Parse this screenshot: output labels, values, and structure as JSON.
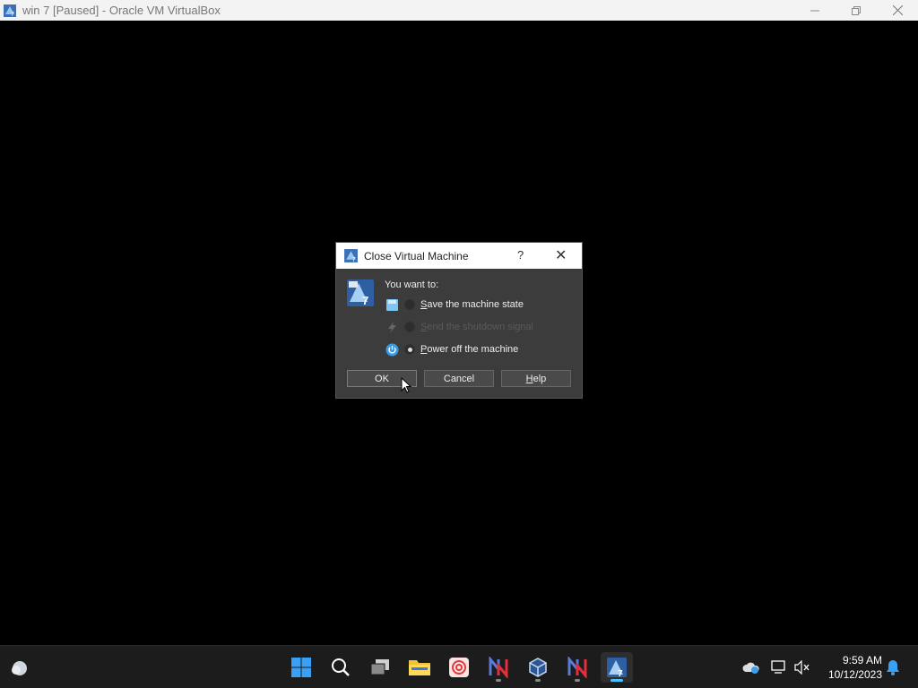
{
  "window": {
    "title": "win 7 [Paused] - Oracle VM VirtualBox",
    "controls": [
      "minimize",
      "restore",
      "close"
    ]
  },
  "dialog": {
    "title": "Close Virtual Machine",
    "help_glyph": "?",
    "close_glyph": "✕",
    "prompt": "You want to:",
    "options": [
      {
        "label_prefix": "S",
        "label_rest": "ave the machine state",
        "icon": "save-state-icon",
        "enabled": true,
        "selected": false
      },
      {
        "label_prefix": "S",
        "label_rest": "end the shutdown signal",
        "icon": "shutdown-signal-icon",
        "enabled": false,
        "selected": false
      },
      {
        "label_prefix": "P",
        "label_rest": "ower off the machine",
        "icon": "power-off-icon",
        "enabled": true,
        "selected": true
      }
    ],
    "buttons": {
      "ok": "OK",
      "cancel": "Cancel",
      "help_prefix": "H",
      "help_rest": "elp"
    }
  },
  "taskbar": {
    "apps": [
      "start",
      "search",
      "task-view",
      "file-explorer",
      "app-swirl",
      "app-n-1",
      "virtualbox",
      "app-n-2",
      "vm-win7"
    ],
    "clock": {
      "time": "9:59 AM",
      "date": "10/12/2023"
    }
  },
  "colors": {
    "accent": "#4cc2ff",
    "dialog_bg": "#3c3c3c",
    "taskbar_bg": "#1c1c1c"
  }
}
